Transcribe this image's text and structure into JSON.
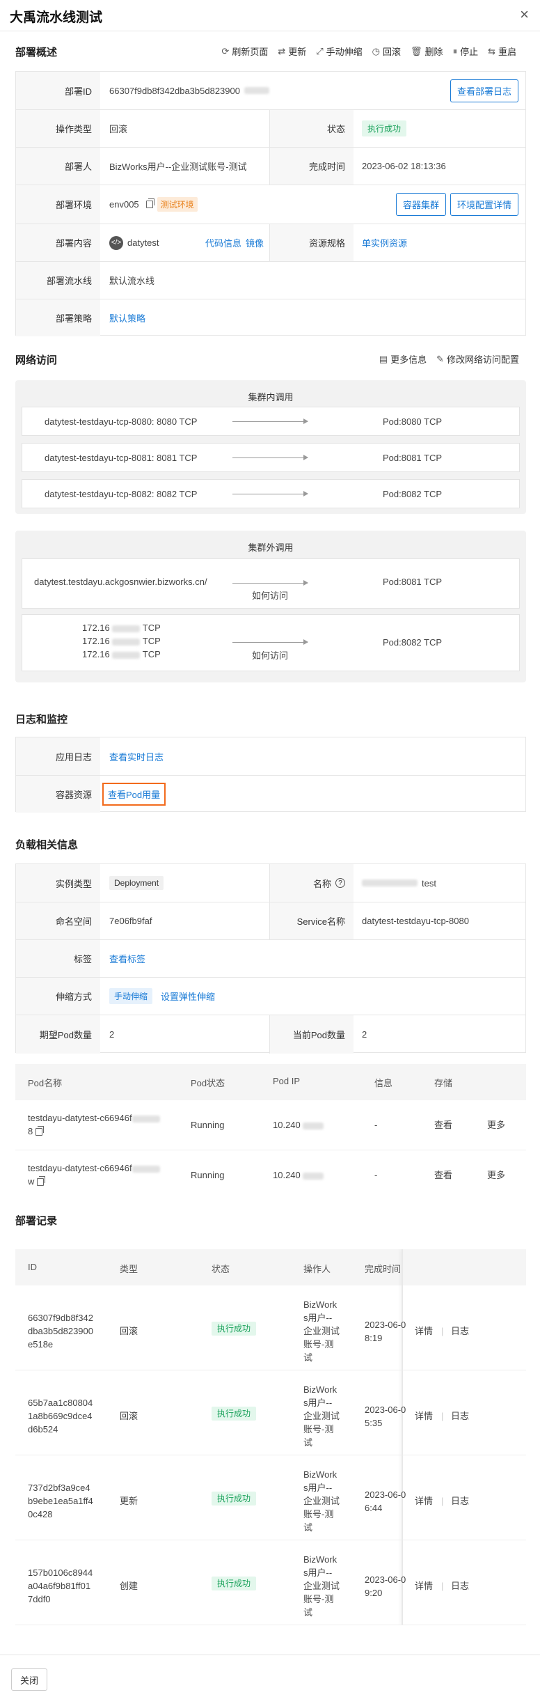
{
  "title": "大禹流水线测试",
  "overview": {
    "title": "部署概述",
    "toolbar": [
      "刷新页面",
      "更新",
      "手动伸缩",
      "回滚",
      "删除",
      "停止",
      "重启"
    ],
    "deploy_id_label": "部署ID",
    "deploy_id": "66307f9db8f342dba3b5d823900",
    "view_log_btn": "查看部署日志",
    "op_type_label": "操作类型",
    "op_type": "回滚",
    "status_label": "状态",
    "status": "执行成功",
    "deployer_label": "部署人",
    "deployer": "BizWorks用户--企业测试账号-测试",
    "finish_label": "完成时间",
    "finish_time": "2023-06-02 18:13:36",
    "env_label": "部署环境",
    "env": "env005",
    "env_tag": "测试环境",
    "cluster_btn": "容器集群",
    "env_cfg_btn": "环境配置详情",
    "content_label": "部署内容",
    "content_app": "datytest",
    "code_info": "代码信息",
    "image": "镜像",
    "spec_label": "资源规格",
    "spec": "单实例资源",
    "pipeline_label": "部署流水线",
    "pipeline": "默认流水线",
    "strategy_label": "部署策略",
    "strategy": "默认策略"
  },
  "network": {
    "title": "网络访问",
    "more_info": "更多信息",
    "edit_cfg": "修改网络访问配置",
    "inner_title": "集群内调用",
    "inner": [
      {
        "src": "datytest-testdayu-tcp-8080: 8080 TCP",
        "dst": "Pod:8080 TCP"
      },
      {
        "src": "datytest-testdayu-tcp-8081: 8081 TCP",
        "dst": "Pod:8081 TCP"
      },
      {
        "src": "datytest-testdayu-tcp-8082: 8082 TCP",
        "dst": "Pod:8082 TCP"
      }
    ],
    "outer_title": "集群外调用",
    "outer1_src": "datytest.testdayu.ackgosnwier.bizworks.cn/",
    "outer1_how": "如何访问",
    "outer1_dst": "Pod:8081 TCP",
    "outer2_ip_prefix": "172.16",
    "outer2_proto": "TCP",
    "outer2_how": "如何访问",
    "outer2_dst": "Pod:8082 TCP"
  },
  "logs": {
    "title": "日志和监控",
    "app_log_label": "应用日志",
    "app_log_link": "查看实时日志",
    "container_label": "容器资源",
    "container_link": "查看Pod用量"
  },
  "workload": {
    "title": "负载相关信息",
    "kind_label": "实例类型",
    "kind": "Deployment",
    "name_label": "名称",
    "name_suffix": "test",
    "ns_label": "命名空间",
    "ns": "7e06fb9faf",
    "svc_label": "Service名称",
    "svc": "datytest-testdayu-tcp-8080",
    "tag_label": "标签",
    "tag_link": "查看标签",
    "scale_label": "伸缩方式",
    "scale_manual": "手动伸缩",
    "scale_elastic": "设置弹性伸缩",
    "expected_label": "期望Pod数量",
    "expected": "2",
    "current_label": "当前Pod数量",
    "current": "2"
  },
  "pods": {
    "headers": [
      "Pod名称",
      "Pod状态",
      "Pod IP",
      "信息",
      "存储"
    ],
    "rows": [
      {
        "name1": "testdayu-datytest-c66946f",
        "name2": "8",
        "status": "Running",
        "ip": "10.240",
        "info": "-",
        "view": "查看",
        "more": "更多"
      },
      {
        "name1": "testdayu-datytest-c66946f",
        "name2": "w",
        "status": "Running",
        "ip": "10.240",
        "info": "-",
        "view": "查看",
        "more": "更多"
      }
    ]
  },
  "records": {
    "title": "部署记录",
    "headers": [
      "ID",
      "类型",
      "状态",
      "操作人",
      "完成时间"
    ],
    "rows": [
      {
        "id": [
          "66307f9db8f342",
          "dba3b5d823900",
          "e518e"
        ],
        "type": "回滚",
        "status": "执行成功",
        "op": [
          "BizWork",
          "s用户--",
          "企业测试",
          "账号-测",
          "试"
        ],
        "time": [
          "2023-06-0",
          "8:19"
        ],
        "detail": "详情",
        "log": "日志"
      },
      {
        "id": [
          "65b7aa1c80804",
          "1a8b669c9dce4",
          "d6b524"
        ],
        "type": "回滚",
        "status": "执行成功",
        "op": [
          "BizWork",
          "s用户--",
          "企业测试",
          "账号-测",
          "试"
        ],
        "time": [
          "2023-06-0",
          "5:35"
        ],
        "detail": "详情",
        "log": "日志"
      },
      {
        "id": [
          "737d2bf3a9ce4",
          "b9ebe1ea5a1ff4",
          "0c428"
        ],
        "type": "更新",
        "status": "执行成功",
        "op": [
          "BizWork",
          "s用户--",
          "企业测试",
          "账号-测",
          "试"
        ],
        "time": [
          "2023-06-0",
          "6:44"
        ],
        "detail": "详情",
        "log": "日志"
      },
      {
        "id": [
          "157b0106c8944",
          "a04a6f9b81ff01",
          "7ddf0"
        ],
        "type": "创建",
        "status": "执行成功",
        "op": [
          "BizWork",
          "s用户--",
          "企业测试",
          "账号-测",
          "试"
        ],
        "time": [
          "2023-06-0",
          "9:20"
        ],
        "detail": "详情",
        "log": "日志"
      }
    ]
  },
  "footer": {
    "close": "关闭"
  },
  "colors": {
    "link": "#1a7bd6",
    "success": "#19a15a",
    "warning_tag": "#e8801a",
    "highlight_border": "#f26b1d"
  }
}
